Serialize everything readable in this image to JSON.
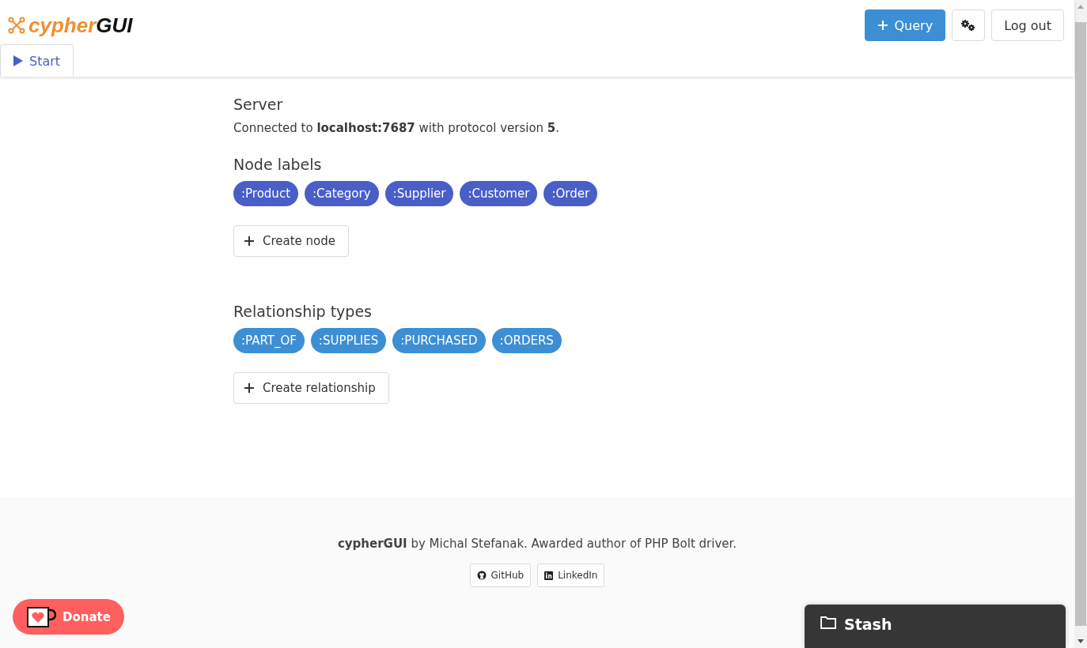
{
  "logo": {
    "primary": "cypher",
    "secondary": "GUI"
  },
  "header_buttons": {
    "query": "Query",
    "logout": "Log out"
  },
  "tabs": [
    {
      "label": "Start",
      "selected": true
    }
  ],
  "server": {
    "title": "Server",
    "text": "Connected to **localhost:7687** with protocol version **5**."
  },
  "node_labels": {
    "title": "Node labels",
    "items": [
      ":Product",
      ":Category",
      ":Supplier",
      ":Customer",
      ":Order"
    ],
    "button": "Create node"
  },
  "relationship_types": {
    "title": "Relationship types",
    "items": [
      ":PART_OF",
      ":SUPPLIES",
      ":PURCHASED",
      ":ORDERS"
    ],
    "button": "Create relationship"
  },
  "footer": {
    "text": "**cypherGUI** by Michal Stefanak. Awarded author of PHP Bolt driver.",
    "links": [
      {
        "kind": "github",
        "label": "GitHub"
      },
      {
        "kind": "linkedin",
        "label": "LinkedIn"
      }
    ]
  },
  "donate": "Donate",
  "stash": "Stash"
}
